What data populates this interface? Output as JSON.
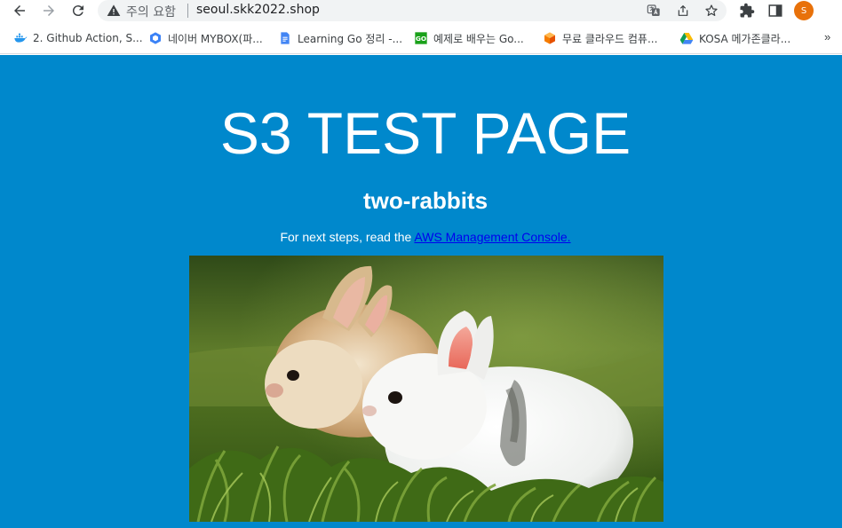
{
  "browser": {
    "security_label": "주의 요함",
    "url": "seoul.skk2022.shop",
    "profile_initial": "S"
  },
  "bookmarks": [
    {
      "label": "2. Github Action, S...",
      "icon": "docker-whale-icon",
      "color": "#2496ed"
    },
    {
      "label": "네이버 MYBOX(파...",
      "icon": "mybox-cube-icon",
      "color": "#3b82f6"
    },
    {
      "label": "Learning Go 정리 -...",
      "icon": "google-docs-icon",
      "color": "#4285f4"
    },
    {
      "label": "예제로 배우는 Go...",
      "icon": "go-badge-icon",
      "color": "#1aa11a"
    },
    {
      "label": "무료 클라우드 컴퓨...",
      "icon": "oracle-cube-icon",
      "color": "#f57c00"
    },
    {
      "label": "KOSA 메가존클라...",
      "icon": "google-drive-icon",
      "color": "#fbbc04"
    }
  ],
  "page": {
    "title": "S3 TEST PAGE",
    "subtitle": "two-rabbits",
    "text_prefix": "For next steps, read the",
    "link_text": "AWS Management Console.",
    "background": "#0088cc"
  }
}
